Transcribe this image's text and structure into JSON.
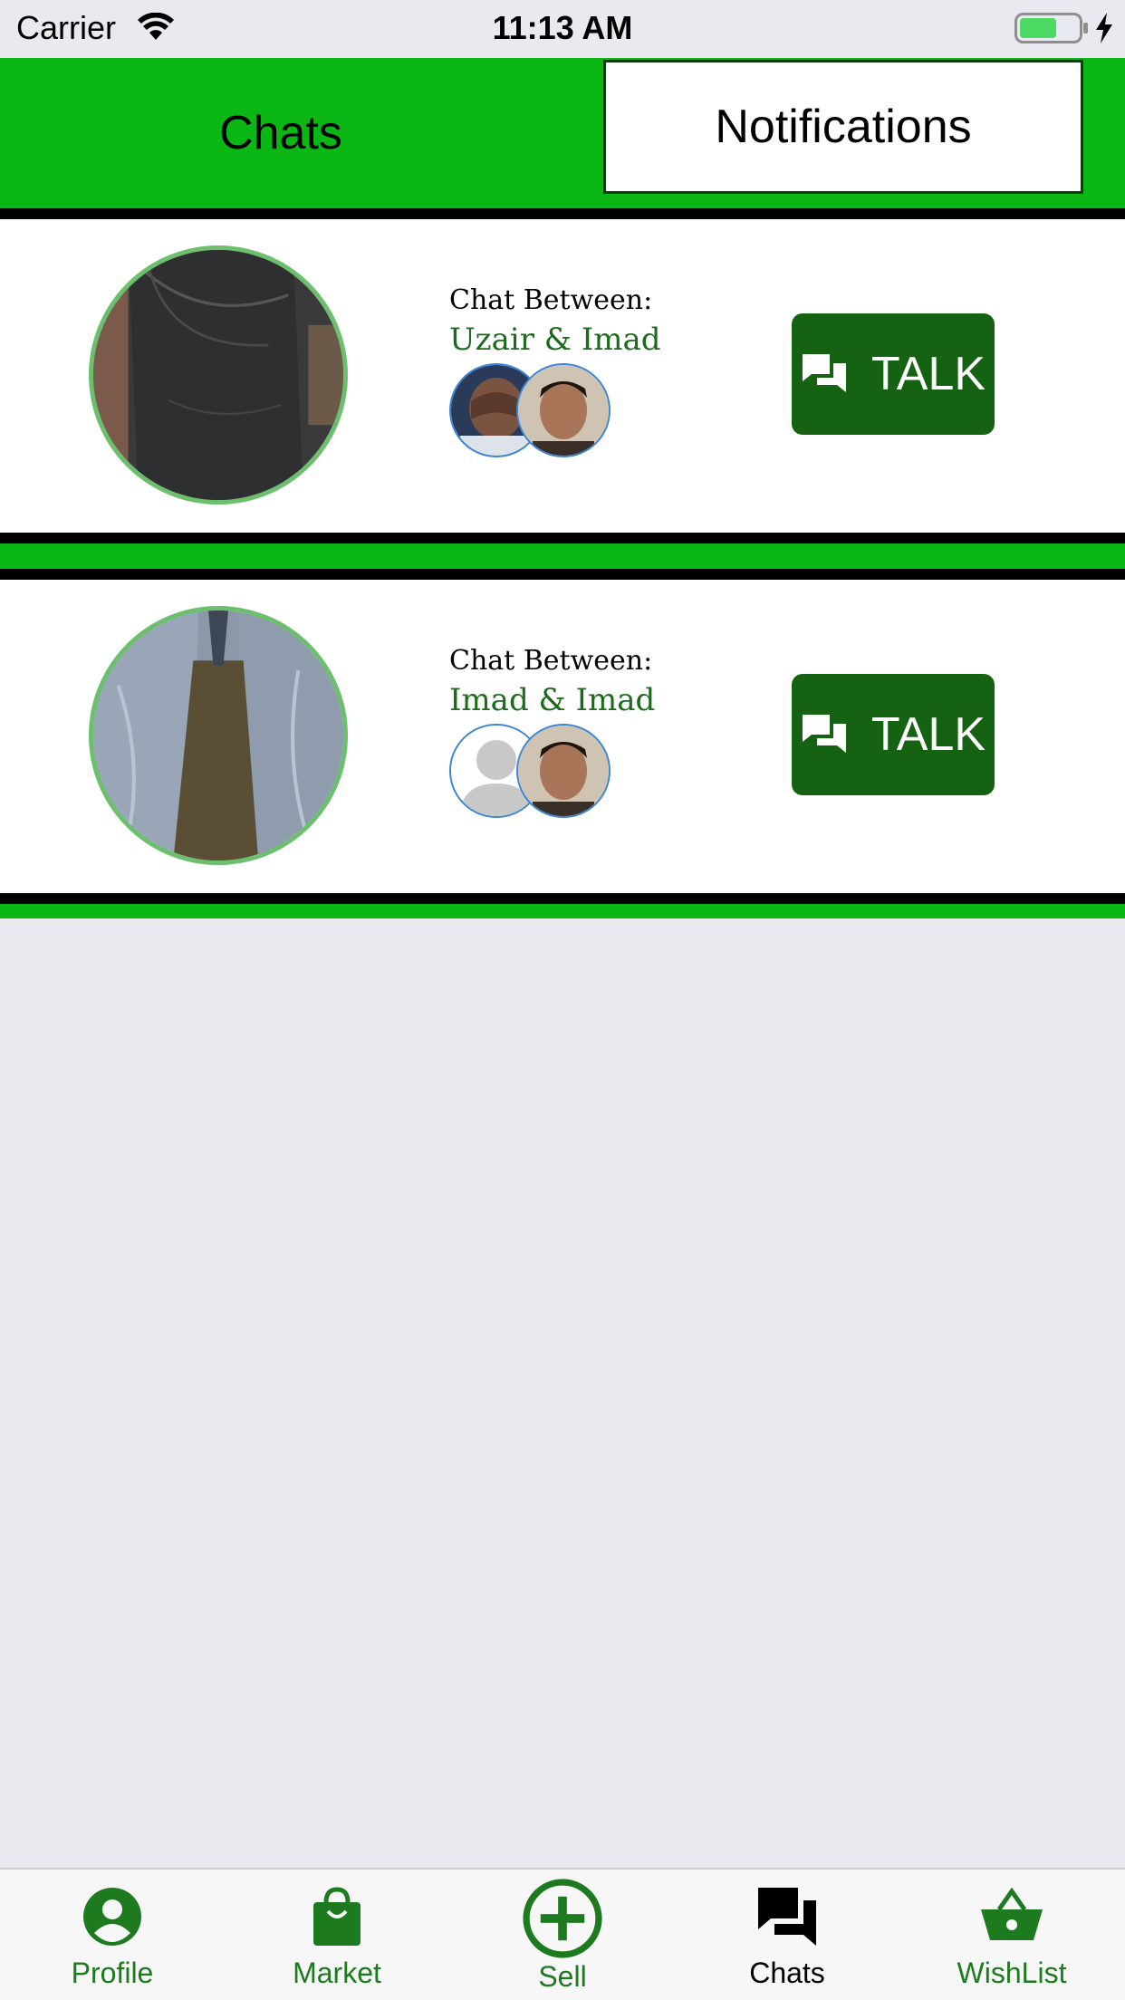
{
  "status_bar": {
    "carrier": "Carrier",
    "time": "11:13 AM"
  },
  "top_tabs": {
    "chats": "Chats",
    "notifications": "Notifications",
    "active": "chats"
  },
  "chats": [
    {
      "label": "Chat Between:",
      "participants": "Uzair & Imad",
      "product_icon": "dark-jeans-photo",
      "talk_label": "TALK"
    },
    {
      "label": "Chat Between:",
      "participants": "Imad & Imad",
      "product_icon": "light-jeans-photo",
      "talk_label": "TALK"
    }
  ],
  "bottom_nav": [
    {
      "label": "Profile",
      "icon": "person-icon",
      "active": false
    },
    {
      "label": "Market",
      "icon": "shopping-bag-icon",
      "active": false
    },
    {
      "label": "Sell",
      "icon": "plus-circle-icon",
      "active": false
    },
    {
      "label": "Chats",
      "icon": "chat-bubbles-icon",
      "active": true
    },
    {
      "label": "WishList",
      "icon": "basket-icon",
      "active": false
    }
  ],
  "colors": {
    "brand_green": "#0bb714",
    "dark_green": "#156212",
    "text_green": "#1c6b1c",
    "nav_green": "#1e7a1e",
    "background": "#e9e9f0"
  }
}
